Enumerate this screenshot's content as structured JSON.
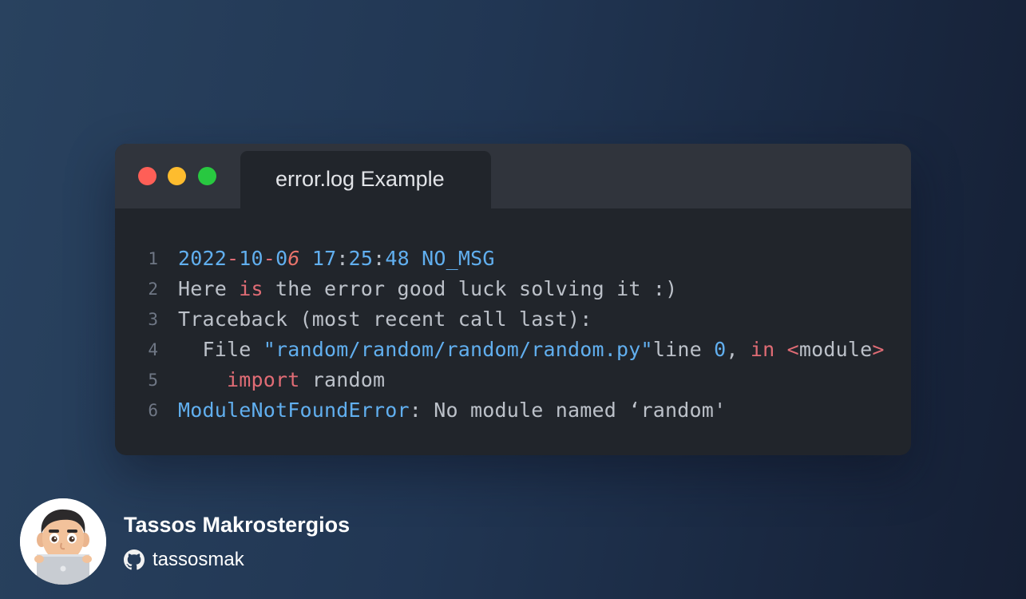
{
  "window": {
    "tab_title": "error.log Example"
  },
  "code_lines": [
    {
      "number": "1",
      "tokens": [
        {
          "text": "2022",
          "style": "blue"
        },
        {
          "text": "-",
          "style": "red"
        },
        {
          "text": "10",
          "style": "blue"
        },
        {
          "text": "-",
          "style": "red"
        },
        {
          "text": "0",
          "style": "blue"
        },
        {
          "text": "6",
          "style": "orange italic"
        },
        {
          "text": " 17",
          "style": "blue"
        },
        {
          "text": ":",
          "style": "plain"
        },
        {
          "text": "25",
          "style": "blue"
        },
        {
          "text": ":",
          "style": "plain"
        },
        {
          "text": "48 NO_MSG",
          "style": "blue"
        }
      ]
    },
    {
      "number": "2",
      "tokens": [
        {
          "text": "Here ",
          "style": "plain"
        },
        {
          "text": "is",
          "style": "red"
        },
        {
          "text": " the error good luck solving it :)",
          "style": "plain"
        }
      ]
    },
    {
      "number": "3",
      "tokens": [
        {
          "text": "Traceback (most recent call last):",
          "style": "plain"
        }
      ]
    },
    {
      "number": "4",
      "tokens": [
        {
          "text": "  File ",
          "style": "plain"
        },
        {
          "text": "\"random/random/random/random.py\"",
          "style": "blue"
        },
        {
          "text": "line ",
          "style": "plain"
        },
        {
          "text": "0",
          "style": "blue"
        },
        {
          "text": ", ",
          "style": "plain"
        },
        {
          "text": "in",
          "style": "red"
        },
        {
          "text": " ",
          "style": "plain"
        },
        {
          "text": "<",
          "style": "red"
        },
        {
          "text": "module",
          "style": "plain"
        },
        {
          "text": ">",
          "style": "red"
        }
      ]
    },
    {
      "number": "5",
      "tokens": [
        {
          "text": "    ",
          "style": "plain"
        },
        {
          "text": "import",
          "style": "red"
        },
        {
          "text": " random",
          "style": "plain"
        }
      ]
    },
    {
      "number": "6",
      "tokens": [
        {
          "text": "ModuleNotFoundError",
          "style": "blue"
        },
        {
          "text": ": No module named ‘random'",
          "style": "plain"
        }
      ]
    }
  ],
  "author": {
    "name": "Tassos Makrostergios",
    "handle": "tassosmak",
    "avatar_icon": "memoji-avatar-icon",
    "handle_icon": "github-icon"
  },
  "colors": {
    "close": "#fe5f57",
    "minimize": "#febc2e",
    "maximize": "#28c840",
    "code_background": "#21252b",
    "titlebar_background": "#30343c",
    "keyword_red": "#e06c75",
    "literal_blue": "#61afef",
    "plain_text": "#bcc1c9"
  }
}
